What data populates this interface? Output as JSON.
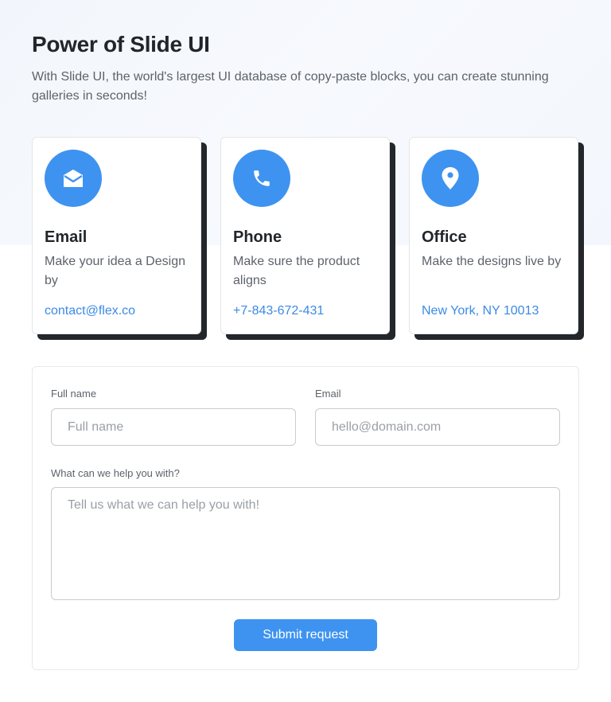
{
  "header": {
    "title": "Power of Slide UI",
    "subtitle": "With Slide UI, the world's largest UI database of copy-paste blocks, you can create stunning galleries in seconds!"
  },
  "cards": [
    {
      "icon": "envelope-icon",
      "title": "Email",
      "text": "Make your idea a Design by",
      "link": "contact@flex.co"
    },
    {
      "icon": "phone-icon",
      "title": "Phone",
      "text": "Make sure the product aligns",
      "link": "+7-843-672-431"
    },
    {
      "icon": "map-pin-icon",
      "title": "Office",
      "text": "Make the designs live by",
      "link": "New York, NY 10013"
    }
  ],
  "form": {
    "full_name": {
      "label": "Full name",
      "placeholder": "Full name",
      "value": ""
    },
    "email": {
      "label": "Email",
      "placeholder": "hello@domain.com",
      "value": ""
    },
    "message": {
      "label": "What can we help you with?",
      "placeholder": "Tell us what we can help you with!",
      "value": ""
    },
    "submit_label": "Submit request"
  },
  "colors": {
    "accent": "#3e93f0",
    "link": "#3b8ae6",
    "card_shadow": "#23272b"
  }
}
